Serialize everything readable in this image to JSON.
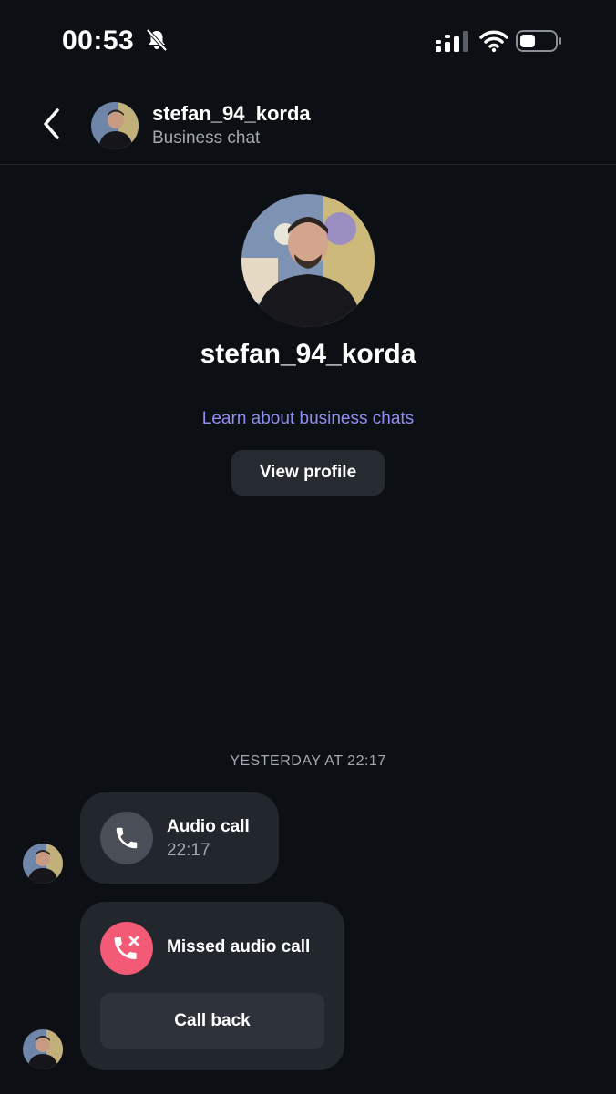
{
  "status_bar": {
    "time": "00:53",
    "icons": [
      "bell-slash-icon",
      "signal-icon",
      "wifi-icon",
      "battery-icon"
    ]
  },
  "header": {
    "username": "stefan_94_korda",
    "subtitle": "Business chat"
  },
  "profile": {
    "username": "stefan_94_korda",
    "learn_link": "Learn about business chats",
    "view_profile_label": "View profile"
  },
  "conversation": {
    "timestamp": "YESTERDAY AT 22:17",
    "messages": [
      {
        "type": "audio-call",
        "title": "Audio call",
        "time": "22:17"
      },
      {
        "type": "missed-call",
        "title": "Missed audio call",
        "action_label": "Call back"
      }
    ]
  },
  "colors": {
    "background": "#0c0f14",
    "bubble": "#22262d",
    "link": "#8d8ff5",
    "missed": "#f25a76"
  }
}
